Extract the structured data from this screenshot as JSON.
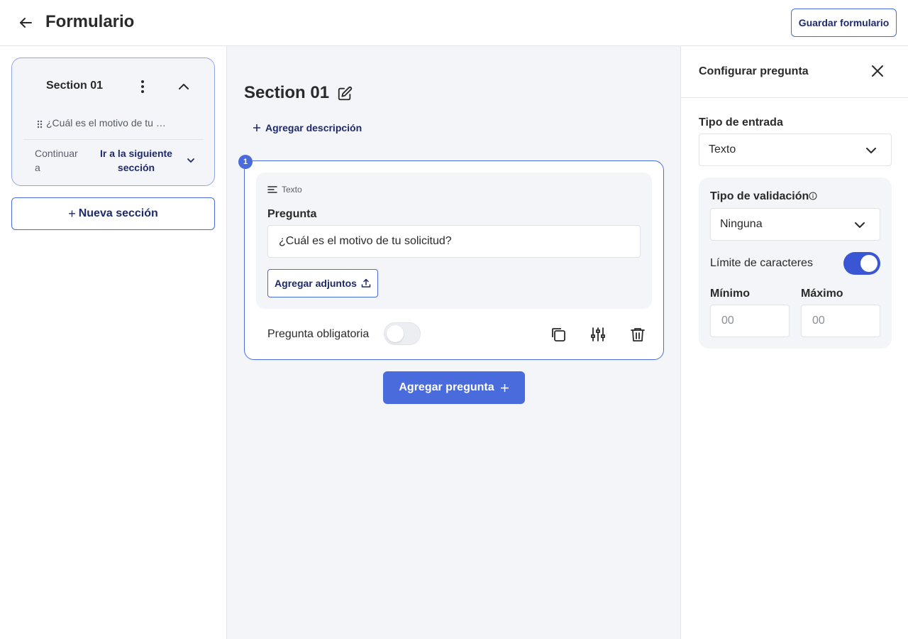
{
  "header": {
    "title": "Formulario",
    "save_label": "Guardar formulario"
  },
  "sidebar": {
    "section": {
      "title": "Section 01",
      "question_preview": "¿Cuál es el motivo de tu …",
      "continue_label": "Continuar a",
      "continue_value": "Ir a la siguiente sección"
    },
    "new_section_label": "Nueva sección"
  },
  "main": {
    "section_title": "Section 01",
    "add_description_label": "Agregar descripción",
    "question": {
      "number": "1",
      "type_label": "Texto",
      "question_label": "Pregunta",
      "question_value": "¿Cuál es el motivo de tu solicitud?",
      "attach_label": "Agregar adjuntos",
      "required_label": "Pregunta obligatoria",
      "required_on": false
    },
    "add_question_label": "Agregar pregunta"
  },
  "config_panel": {
    "title": "Configurar pregunta",
    "input_type_label": "Tipo de entrada",
    "input_type_value": "Texto",
    "validation_label": "Tipo de validación",
    "validation_value": "Ninguna",
    "char_limit_label": "Límite de caracteres",
    "char_limit_on": true,
    "min_label": "Mínimo",
    "min_placeholder": "00",
    "max_label": "Máximo",
    "max_placeholder": "00"
  },
  "colors": {
    "accent": "#4a6bdc",
    "accent_dark": "#1f2a6b",
    "toggle_on": "#3a56d4",
    "canvas_bg": "#f4f5f8"
  },
  "icons": [
    "arrow-left-icon",
    "kebab-icon",
    "chevron-up-icon",
    "drag-handle-icon",
    "chevron-down-icon",
    "plus-icon",
    "edit-icon",
    "text-lines-icon",
    "upload-icon",
    "copy-icon",
    "sliders-icon",
    "trash-icon",
    "close-icon",
    "info-icon"
  ]
}
